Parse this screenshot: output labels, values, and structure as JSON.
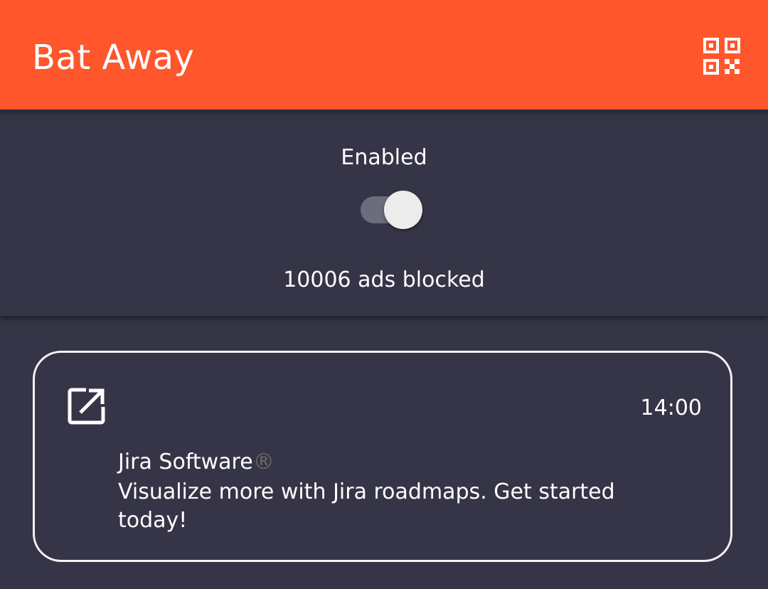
{
  "app_bar": {
    "title": "Bat Away",
    "background_color": "#ff562c",
    "qr_icon": "qr-code-icon"
  },
  "status": {
    "enabled_label": "Enabled",
    "toggle_on": true,
    "ads_blocked_text": "10006 ads blocked"
  },
  "notification": {
    "icon": "open-in-new-icon",
    "time": "14:00",
    "title": "Jira Software",
    "title_mark": "®",
    "body": "Visualize more with Jira roadmaps. Get started today!"
  },
  "colors": {
    "background": "#353547",
    "accent": "#ff562c",
    "text": "#ffffff"
  }
}
